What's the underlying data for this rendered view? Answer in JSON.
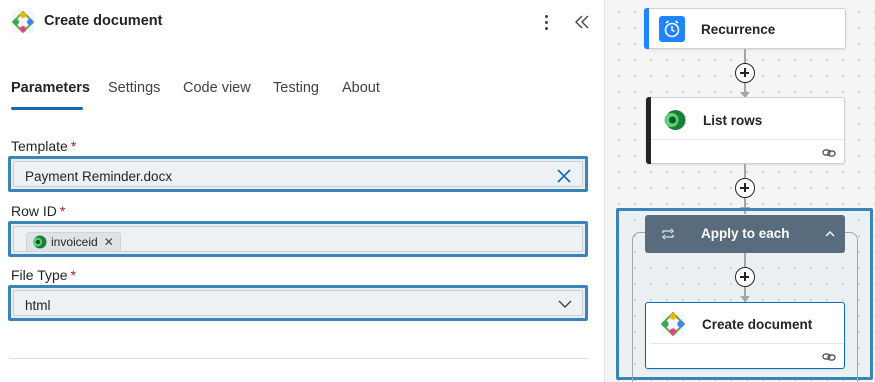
{
  "panel": {
    "title": "Create document",
    "icon": "create-document-icon",
    "menu_icon": "more-vertical-icon",
    "collapse_icon": "collapse-panel-icon"
  },
  "tabs": [
    {
      "label": "Parameters",
      "active": true
    },
    {
      "label": "Settings",
      "active": false
    },
    {
      "label": "Code view",
      "active": false
    },
    {
      "label": "Testing",
      "active": false
    },
    {
      "label": "About",
      "active": false
    }
  ],
  "fields": {
    "template": {
      "label": "Template",
      "required_mark": "*",
      "value": "Payment Reminder.docx"
    },
    "row_id": {
      "label": "Row ID",
      "required_mark": "*",
      "token": "invoiceid",
      "token_remove": "✕"
    },
    "file_type": {
      "label": "File Type",
      "required_mark": "*",
      "value": "html"
    }
  },
  "flow": {
    "steps": [
      {
        "title": "Recurrence",
        "icon": "clock-icon",
        "accent": "#1f85ff"
      },
      {
        "title": "List rows",
        "icon": "dataverse-icon",
        "accent": "#242424"
      },
      {
        "title": "Apply to each",
        "icon": "loop-icon",
        "header_color": "#586c7e"
      },
      {
        "title": "Create document",
        "icon": "create-document-icon"
      }
    ]
  },
  "colors": {
    "highlight": "#3a84b7",
    "active_tab": "#0f6cbd",
    "required": "#c50f1f"
  }
}
